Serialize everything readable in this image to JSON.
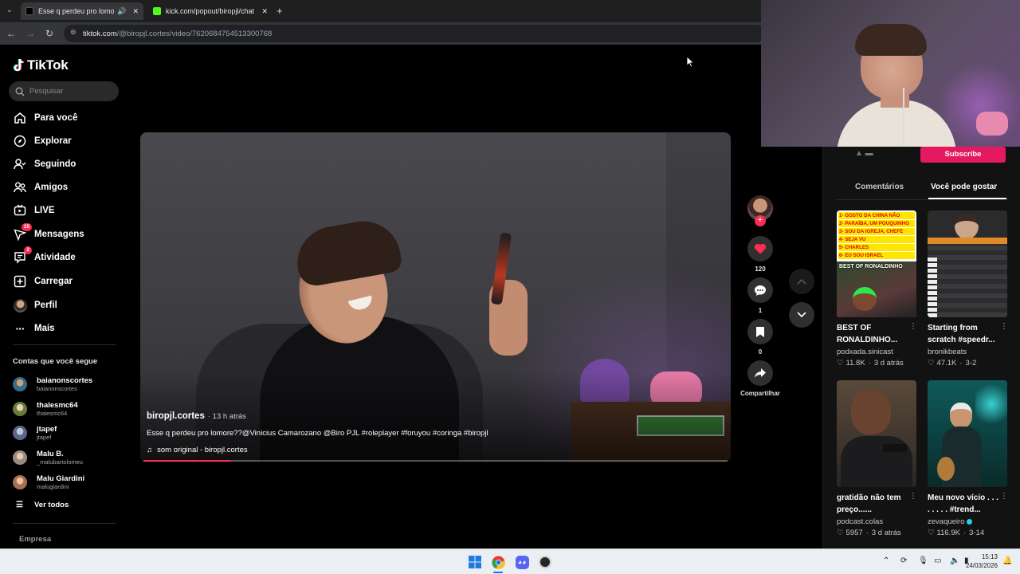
{
  "browser": {
    "tabs": [
      {
        "title": "Esse q perdeu pro lomore?? |",
        "active": true
      },
      {
        "title": "kick.com/popout/biropjl/chat",
        "active": false
      }
    ],
    "url_host": "tiktok.com",
    "url_path": "/@biropjl.cortes/video/7620684754513300768"
  },
  "tiktok": {
    "brand": "TikTok",
    "search_placeholder": "Pesquisar",
    "nav": [
      {
        "label": "Para você",
        "icon": "home-icon"
      },
      {
        "label": "Explorar",
        "icon": "compass-icon"
      },
      {
        "label": "Seguindo",
        "icon": "following-icon"
      },
      {
        "label": "Amigos",
        "icon": "friends-icon"
      },
      {
        "label": "LIVE",
        "icon": "live-icon"
      },
      {
        "label": "Mensagens",
        "icon": "messages-icon",
        "badge": "15"
      },
      {
        "label": "Atividade",
        "icon": "activity-icon",
        "badge": "2"
      },
      {
        "label": "Carregar",
        "icon": "upload-icon"
      },
      {
        "label": "Perfil",
        "icon": "profile-icon"
      },
      {
        "label": "Mais",
        "icon": "more-icon"
      }
    ],
    "following_title": "Contas que você segue",
    "following": [
      {
        "name": "baianonscortes",
        "handle": "baianonscortes"
      },
      {
        "name": "thalesmc64",
        "handle": "thalesmc64"
      },
      {
        "name": "jtapef",
        "handle": "jtapef"
      },
      {
        "name": "Malu B.",
        "handle": "_malubartolomeu"
      },
      {
        "name": "Malu Giardini",
        "handle": "malugiardini"
      }
    ],
    "see_all": "Ver todos",
    "footer_link": "Empresa"
  },
  "video": {
    "author": "biropjl.cortes",
    "time": "· 13 h atrás",
    "caption": "Esse q perdeu pro lomore??@Vinicius Camarozano @Biro PJL #roleplayer #foruyou #coringa #biropjl",
    "sound": "som original - biropjl.cortes",
    "progress": 0.15
  },
  "actions": {
    "likes": "120",
    "comments": "1",
    "saves": "0",
    "share": "Compartilhar"
  },
  "panel": {
    "tabs": [
      "Comentários",
      "Você pode gostar"
    ],
    "subscribe": "Subscribe",
    "cards": [
      {
        "title": "BEST OF RONALDINHO...",
        "author": "podxada.sinicast",
        "likes": "11.8K",
        "date": "3 d atrás",
        "thumb_lines": [
          "1- GOSTO DA CHINA NÃO",
          "2- PARAÍBA, UM POUQUINHO",
          "3- SOU DA IGREJA, CHEFE",
          "4- SEJA VU",
          "5- CHARLES",
          "6- EU SOU ISRAEL",
          "BEST OF RONALDINHO"
        ]
      },
      {
        "title": "Starting from scratch #speedr...",
        "author": "bronikbeats",
        "likes": "47.1K",
        "date": "3-2",
        "thumb_lines": []
      },
      {
        "title": "gratidão não tem preço......",
        "author": "podcast.colas",
        "likes": "5957",
        "date": "3 d atrás",
        "thumb_lines": []
      },
      {
        "title": "Meu novo vício . . . . . . . . #trend...",
        "author": "zevaqueiro",
        "likes": "116.9K",
        "date": "3-14",
        "thumb_lines": []
      }
    ]
  },
  "taskbar": {
    "time": "15:13",
    "date": "24/03/2026"
  },
  "colors": {
    "accent": "#fe2c55",
    "background": "#000000",
    "panel": "#121212"
  }
}
